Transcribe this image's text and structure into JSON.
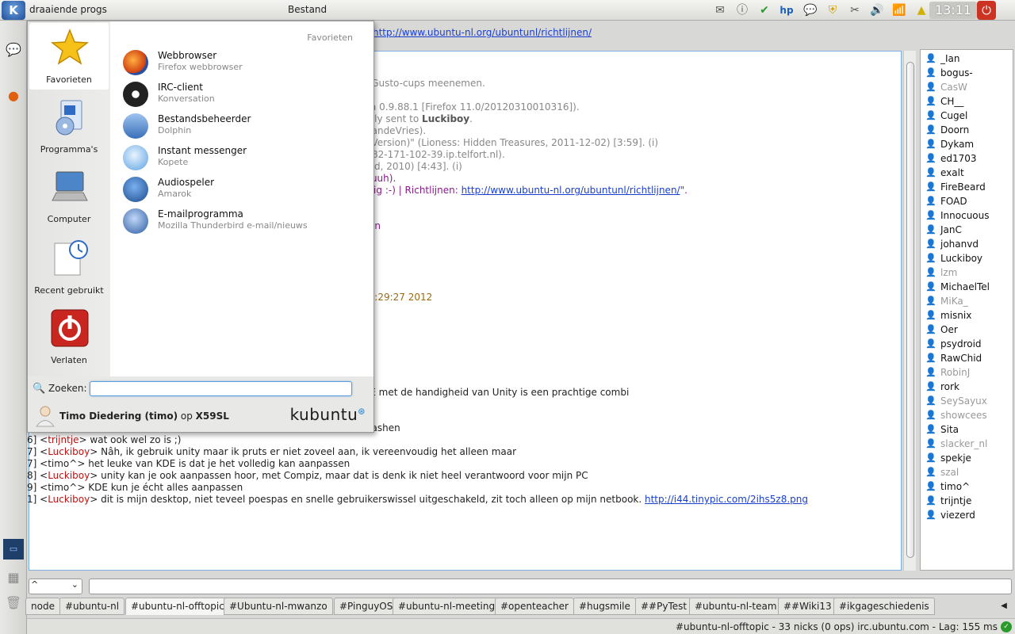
{
  "top_panel": {
    "kde_button": "K",
    "task_label": "draaiende progs",
    "menu_label": "Bestand",
    "clock": "13:11"
  },
  "url_line": "http://www.ubuntu-nl.org/ubuntunl/richtlijnen/",
  "chat_lines": {
    "l1": "e Gusto-cups meenemen.",
    "l2": "illa 0.9.88.1 [Firefox 11.0/20120310010316]).",
    "l3a": "fully sent to ",
    "l3b": "Luckiboy",
    "l3c": ".",
    "l4": "efandeVries).",
    "l5": "8 Version)\" (Lioness: Hidden Treasures, 2011-12-02) [3:59]. (i)",
    "l6": "@82-171-102-39.ip.telfort.nl).",
    "l7": "ond, 2010) [4:43]. (i)",
    "l8": "pjuuh).",
    "l9a": "ellig :-) | Richtlijnen: ",
    "l9b": "http://www.ubuntu-nl.org/ubuntunl/richtlijnen/",
    "l9c": "\".",
    "l10": "tion",
    "l11": "11:29:27 2012",
    "l12": "DE met de handigheid van Unity is een prachtige combi",
    "l13": "crashen",
    "m1_ts": "6]",
    "m1_nick": "trijntje",
    "m1_text": " wat ook wel zo is ;)",
    "m2_ts": "7]",
    "m2_nick": "Luckiboy",
    "m2_text": " Nâh, ik gebruik unity maar ik pruts er niet zoveel aan, ik vereenvoudig het alleen maar",
    "m3_ts": "7]",
    "m3_nick": "timo^",
    "m3_text": " het leuke van KDE is dat je het volledig kan aanpassen",
    "m4_ts": "8]",
    "m4_nick": "Luckiboy",
    "m4_text": " unity kan je ook aanpassen hoor, met Compiz, maar dat is denk ik niet heel verantwoord voor mijn PC",
    "m5_ts": "9]",
    "m5_nick": "timo^",
    "m5_text": " KDE kun je écht alles aanpassen",
    "m6_ts": "1]",
    "m6_nick": "Luckiboy",
    "m6_text": " dit is mijn desktop, niet teveel poespas en snelle gebruikerswissel uitgeschakeld, zit toch alleen op mijn netbook. ",
    "m6_link": "http://i44.tinypic.com/2ihs5z8.png"
  },
  "nicks": [
    {
      "name": "_Ian",
      "away": false
    },
    {
      "name": "bogus-",
      "away": false
    },
    {
      "name": "CasW",
      "away": true
    },
    {
      "name": "CH__",
      "away": false
    },
    {
      "name": "Cugel",
      "away": false
    },
    {
      "name": "Doorn",
      "away": false
    },
    {
      "name": "Dykam",
      "away": false
    },
    {
      "name": "ed1703",
      "away": false
    },
    {
      "name": "exalt",
      "away": false
    },
    {
      "name": "FireBeard",
      "away": false
    },
    {
      "name": "FOAD",
      "away": false
    },
    {
      "name": "Innocuous",
      "away": false
    },
    {
      "name": "JanC",
      "away": false
    },
    {
      "name": "johanvd",
      "away": false
    },
    {
      "name": "Luckiboy",
      "away": false
    },
    {
      "name": "lzm",
      "away": true
    },
    {
      "name": "MichaelTel",
      "away": false
    },
    {
      "name": "MiKa_",
      "away": true
    },
    {
      "name": "misnix",
      "away": false
    },
    {
      "name": "Oer",
      "away": false
    },
    {
      "name": "psydroid",
      "away": false
    },
    {
      "name": "RawChid",
      "away": false
    },
    {
      "name": "RobinJ",
      "away": true
    },
    {
      "name": "rork",
      "away": false
    },
    {
      "name": "SeySayux",
      "away": true
    },
    {
      "name": "showcees",
      "away": true
    },
    {
      "name": "Sita",
      "away": false
    },
    {
      "name": "slacker_nl",
      "away": true
    },
    {
      "name": "spekje",
      "away": false
    },
    {
      "name": "szal",
      "away": true
    },
    {
      "name": "timo^",
      "away": false
    },
    {
      "name": "trijntje",
      "away": false
    },
    {
      "name": "viezerd",
      "away": false
    }
  ],
  "input": {
    "nick_combo": "^",
    "combo_arrow": "⌄"
  },
  "tabs": [
    "node",
    "#ubuntu-nl",
    "#ubuntu-nl-offtopic",
    "#Ubuntu-nl-mwanzo",
    "#PinguyOS",
    "#ubuntu-nl-meeting",
    "#openteacher",
    "#hugsmile",
    "##PyTest",
    "#ubuntu-nl-team",
    "##Wiki13",
    "#ikgageschiedenis"
  ],
  "active_tab": 2,
  "tab_more": "◀",
  "status_text": "#ubuntu-nl-offtopic - 33 nicks (0 ops)   irc.ubuntu.com - Lag: 155 ms",
  "kickoff": {
    "side_tabs": {
      "favorites": "Favorieten",
      "programs": "Programma's",
      "computer": "Computer",
      "recent": "Recent gebruikt",
      "leave": "Verlaten"
    },
    "header": "Favorieten",
    "favorites": [
      {
        "title": "Webbrowser",
        "subtitle": "Firefox webbrowser"
      },
      {
        "title": "IRC-client",
        "subtitle": "Konversation"
      },
      {
        "title": "Bestandsbeheerder",
        "subtitle": "Dolphin"
      },
      {
        "title": "Instant messenger",
        "subtitle": "Kopete"
      },
      {
        "title": "Audiospeler",
        "subtitle": "Amarok"
      },
      {
        "title": "E-mailprogramma",
        "subtitle": "Mozilla Thunderbird e-mail/nieuws"
      }
    ],
    "search_label": "Zoeken:",
    "search_value": "",
    "user_name": "Timo Diedering (timo)",
    "user_on": " op ",
    "host": "X59SL",
    "logo": "kubuntu"
  },
  "colors": {
    "nick_red": "#c01010",
    "link_blue": "#1a3fd0",
    "topic_purple": "#8a1a8a",
    "accent_blue": "#5b9bd8"
  }
}
